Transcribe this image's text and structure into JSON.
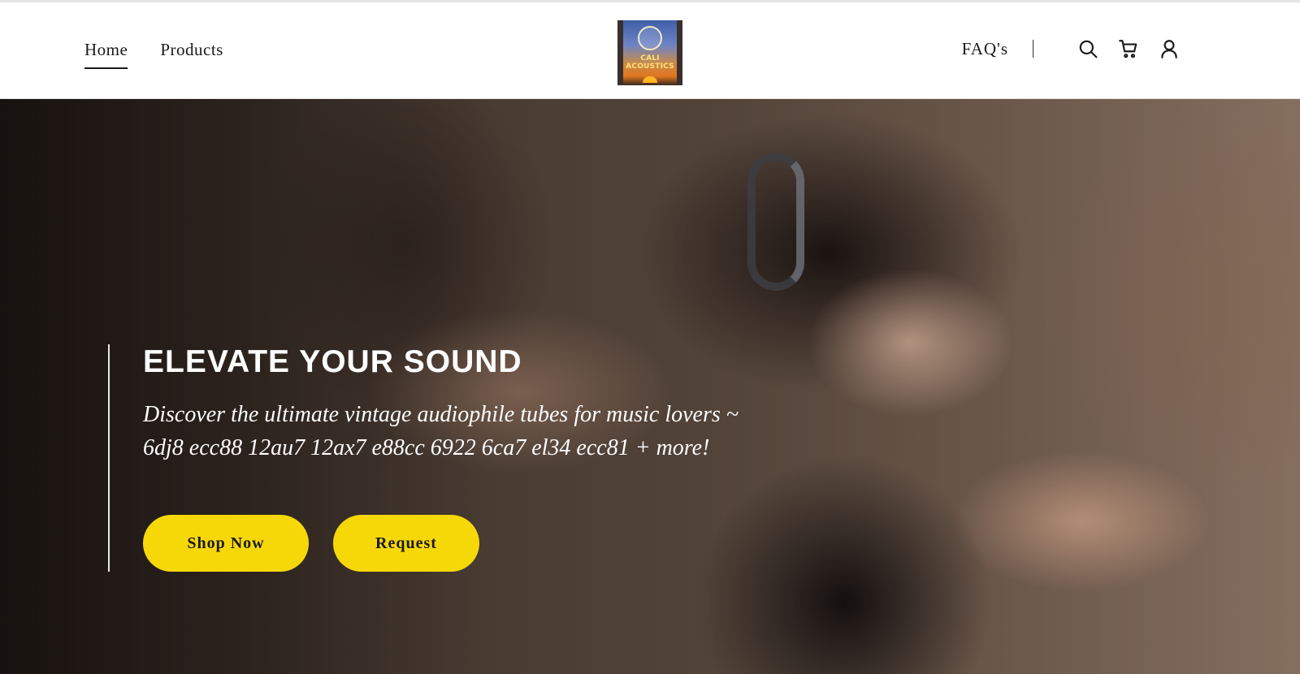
{
  "header": {
    "nav": [
      {
        "label": "Home",
        "active": true
      },
      {
        "label": "Products",
        "active": false
      }
    ],
    "logo": {
      "text_line1": "CALI",
      "text_line2": "ACOUSTICS"
    },
    "faq_label": "FAQ's",
    "icons": [
      "search-icon",
      "cart-icon",
      "user-icon"
    ]
  },
  "hero": {
    "title": "ELEVATE YOUR SOUND",
    "subtitle": "Discover the ultimate vintage audiophile tubes for music lovers  ~ 6dj8 ecc88 12au7 12ax7 e88cc 6922 6ca7 el34 ecc81 + more!",
    "buttons": {
      "shop": "Shop Now",
      "request": "Request"
    }
  },
  "colors": {
    "accent": "#f6d809",
    "text_dark": "#1b1b1b",
    "header_bg": "#ffffff"
  }
}
